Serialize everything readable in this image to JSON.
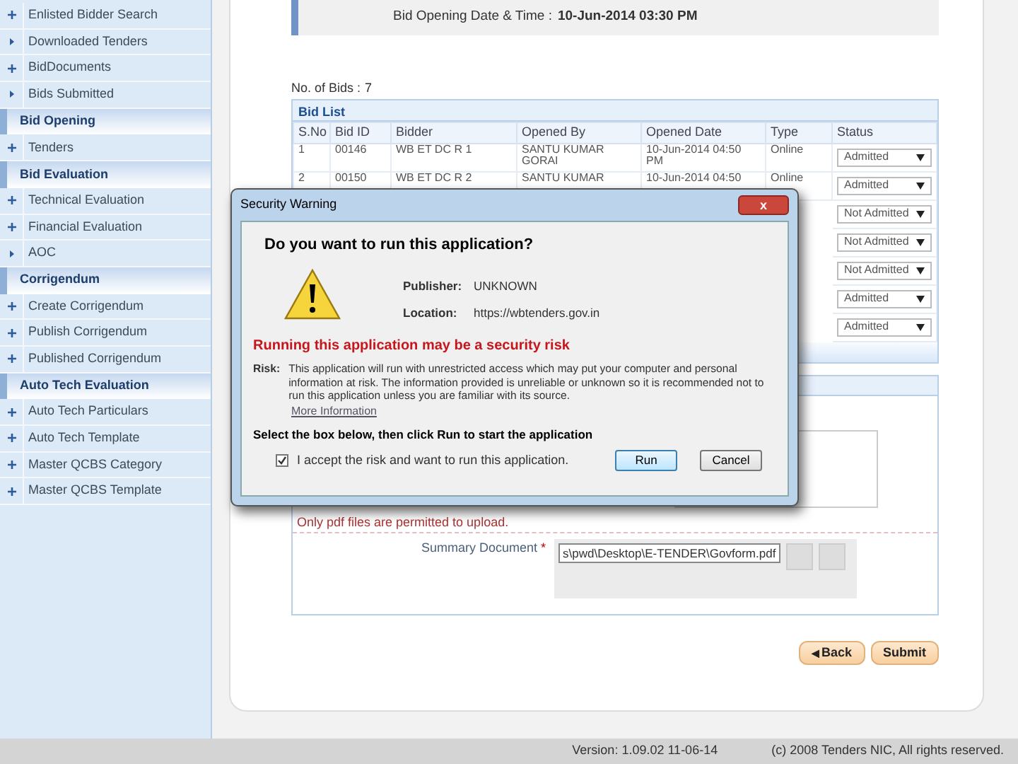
{
  "sidebar": {
    "items": [
      {
        "kind": "plus_item",
        "label": "Enlisted Bidder Search"
      },
      {
        "kind": "arrow_item",
        "label": "Downloaded Tenders"
      },
      {
        "kind": "plus_item",
        "label": "BidDocuments"
      },
      {
        "kind": "arrow_item",
        "label": "Bids Submitted"
      },
      {
        "kind": "header",
        "label": "Bid Opening"
      },
      {
        "kind": "plus_item",
        "label": "Tenders"
      },
      {
        "kind": "header",
        "label": "Bid Evaluation"
      },
      {
        "kind": "plus_item",
        "label": "Technical Evaluation"
      },
      {
        "kind": "plus_item",
        "label": "Financial Evaluation"
      },
      {
        "kind": "arrow_item",
        "label": "AOC"
      },
      {
        "kind": "header",
        "label": "Corrigendum"
      },
      {
        "kind": "plus_item",
        "label": "Create Corrigendum"
      },
      {
        "kind": "plus_item",
        "label": "Publish Corrigendum"
      },
      {
        "kind": "plus_item",
        "label": "Published Corrigendum"
      },
      {
        "kind": "header",
        "label": "Auto Tech Evaluation"
      },
      {
        "kind": "plus_item",
        "label": "Auto Tech Particulars"
      },
      {
        "kind": "plus_item",
        "label": "Auto Tech Template"
      },
      {
        "kind": "plus_item",
        "label": "Master QCBS Category"
      },
      {
        "kind": "plus_item",
        "label": "Master QCBS Template"
      }
    ]
  },
  "opening": {
    "label": "Bid Opening Date & Time :",
    "value": "10-Jun-2014 03:30 PM"
  },
  "bid_count": {
    "label": "No. of Bids :",
    "value": "7"
  },
  "bid_list": {
    "title": "Bid List",
    "columns": [
      "S.No",
      "Bid ID",
      "Bidder",
      "Opened By",
      "Opened Date",
      "Type",
      "Status"
    ],
    "rows": [
      {
        "cells": [
          "1",
          "00146",
          "WB ET DC R 1",
          "SANTU KUMAR GORAI",
          "10-Jun-2014 04:50 PM",
          "Online"
        ],
        "status": "Admitted"
      },
      {
        "cells": [
          "2",
          "00150",
          "WB ET DC R 2",
          "SANTU KUMAR",
          "10-Jun-2014 04:50",
          "Online"
        ],
        "status": "Admitted"
      },
      {
        "cells": [],
        "status": "Not Admitted"
      },
      {
        "cells": [],
        "status": "Not Admitted"
      },
      {
        "cells": [],
        "status": "Not Admitted"
      },
      {
        "cells": [],
        "status": "Admitted"
      },
      {
        "cells": [],
        "status": "Admitted"
      }
    ]
  },
  "upload": {
    "note": "Only pdf files are permitted to upload.",
    "label": "Summary Document",
    "required_mark": "*",
    "file_value": "s\\pwd\\Desktop\\E-TENDER\\Govform.pdf"
  },
  "buttons": [
    {
      "label": "Back",
      "icon": "◀"
    },
    {
      "label": "Submit"
    }
  ],
  "footer": {
    "version": "Version: 1.09.02 11-06-14",
    "copyright": "(c) 2008 Tenders NIC, All rights reserved."
  },
  "dialog": {
    "title": "Security Warning",
    "close": "x",
    "heading": "Do you want to run this application?",
    "publisher_label": "Publisher:",
    "publisher": "UNKNOWN",
    "location_label": "Location:",
    "location": "https://wbtenders.gov.in",
    "warning": "Running this application may be a security risk",
    "risk_label": "Risk:",
    "risk": "This application will run with unrestricted access which may put your computer and personal information at risk. The information provided is unreliable or unknown so it is recommended not to run this application unless you are familiar with its source.",
    "more_info": "More Information",
    "instruction": "Select the box below, then click **Run** to start the application",
    "accept": {
      "label": "I accept the risk and want to run this application.",
      "checked": true
    },
    "buttons": [
      {
        "kind": "default",
        "label": "Run"
      },
      {
        "kind": "normal",
        "label": "Cancel"
      }
    ]
  }
}
